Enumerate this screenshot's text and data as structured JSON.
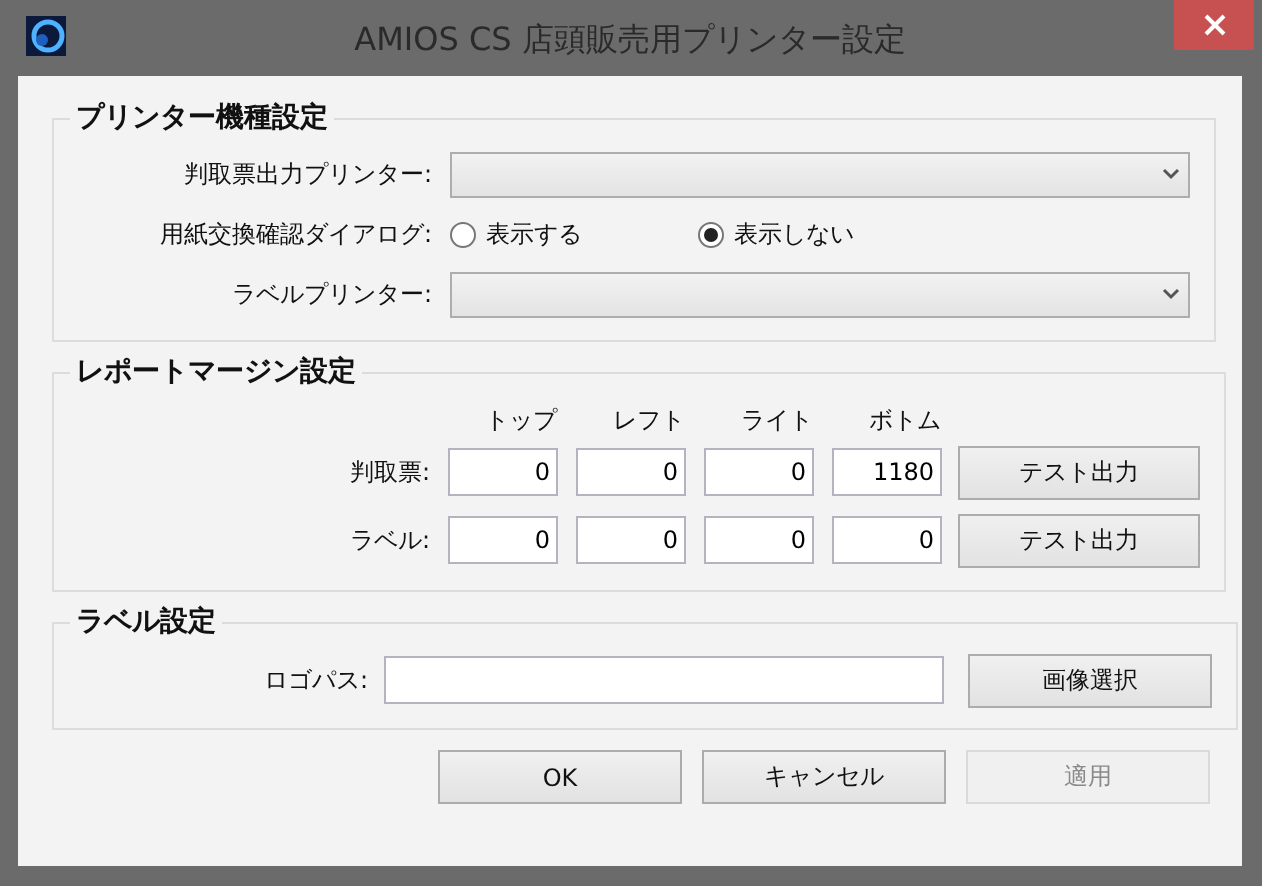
{
  "window": {
    "title": "AMIOS CS 店頭販売用プリンター設定"
  },
  "printer_model": {
    "title": "プリンター機種設定",
    "output_printer": {
      "label": "判取票出力プリンター:"
    },
    "dialog": {
      "label": "用紙交換確認ダイアログ:",
      "options": [
        {
          "label": "表示する",
          "selected": false
        },
        {
          "label": "表示しない",
          "selected": true
        }
      ]
    },
    "label_printer": {
      "label": "ラベルプリンター:"
    }
  },
  "margins": {
    "title": "レポートマージン設定",
    "columns": [
      "トップ",
      "レフト",
      "ライト",
      "ボトム"
    ],
    "rows": [
      {
        "label": "判取票:",
        "values": [
          "0",
          "0",
          "0",
          "1180"
        ],
        "button": "テスト出力"
      },
      {
        "label": "ラベル:",
        "values": [
          "0",
          "0",
          "0",
          "0"
        ],
        "button": "テスト出力"
      }
    ]
  },
  "label_settings": {
    "title": "ラベル設定",
    "logo_path": {
      "label": "ロゴパス:"
    },
    "button": "画像選択"
  },
  "buttons": [
    {
      "label": "OK",
      "disabled": false
    },
    {
      "label": "キャンセル",
      "disabled": false
    },
    {
      "label": "適用",
      "disabled": true
    }
  ]
}
